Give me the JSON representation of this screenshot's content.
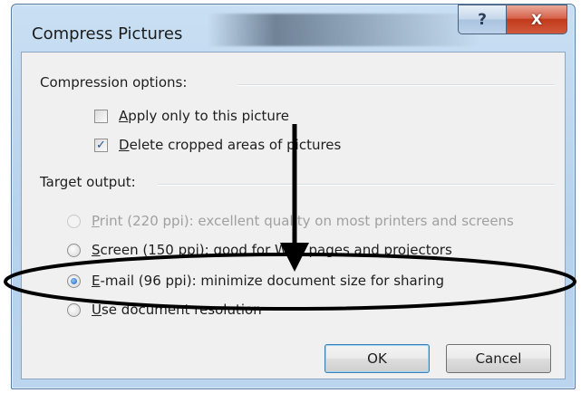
{
  "window": {
    "title": "Compress Pictures",
    "help_glyph": "?",
    "close_glyph": "X"
  },
  "compression": {
    "header": "Compression options:",
    "apply_only": {
      "label": "Apply only to this picture",
      "checked": false
    },
    "delete_cropped": {
      "label": "Delete cropped areas of pictures",
      "checked": true,
      "check_glyph": "✓"
    }
  },
  "target": {
    "header": "Target output:",
    "options": [
      {
        "label": "Print (220 ppi): excellent quality on most printers and screens",
        "disabled": true,
        "selected": false
      },
      {
        "label": "Screen (150 ppi): good for Web pages and projectors",
        "disabled": false,
        "selected": false
      },
      {
        "label": "E-mail (96 ppi): minimize document size for sharing",
        "disabled": false,
        "selected": true
      },
      {
        "label": "Use document resolution",
        "disabled": false,
        "selected": false
      }
    ]
  },
  "buttons": {
    "ok": "OK",
    "cancel": "Cancel"
  },
  "annotation": {
    "color": "#000000"
  }
}
